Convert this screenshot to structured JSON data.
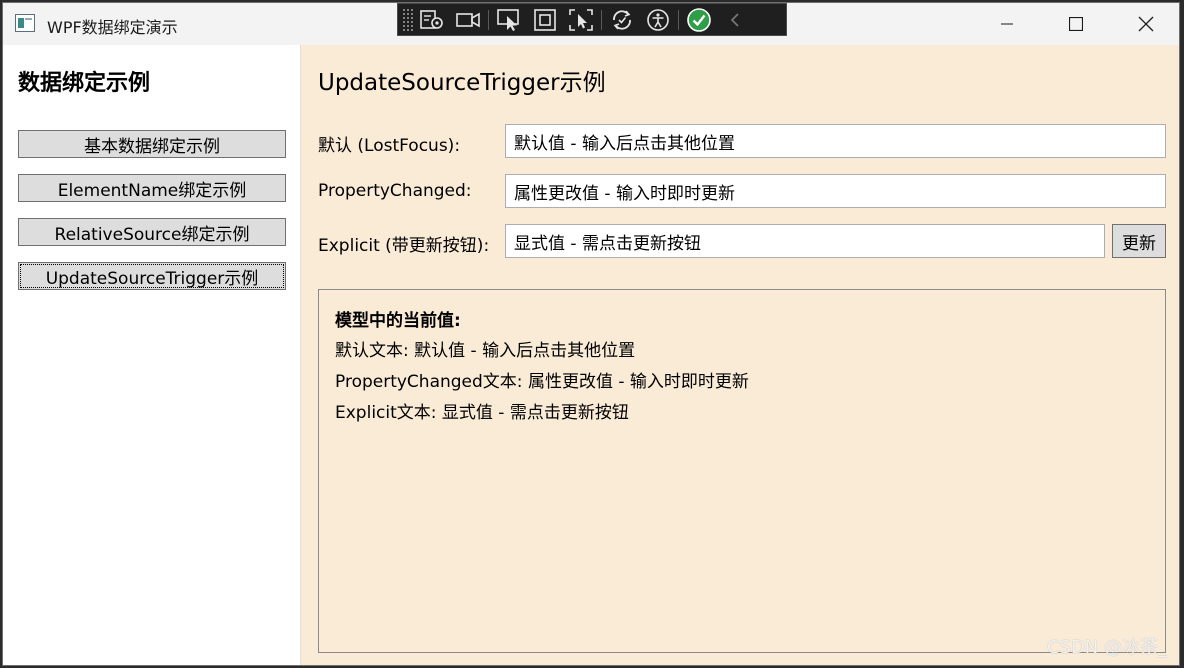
{
  "window": {
    "title": "WPF数据绑定演示"
  },
  "debug_toolbar": {
    "icons": [
      "select-element-icon",
      "record-icon",
      "inspect-pointer-icon",
      "layout-bounds-icon",
      "track-focus-icon",
      "hot-reload-icon",
      "accessibility-icon",
      "status-ok-icon",
      "collapse-chevron-icon"
    ]
  },
  "sidebar": {
    "title": "数据绑定示例",
    "items": [
      {
        "label": "基本数据绑定示例"
      },
      {
        "label": "ElementName绑定示例"
      },
      {
        "label": "RelativeSource绑定示例"
      },
      {
        "label": "UpdateSourceTrigger示例"
      }
    ]
  },
  "main": {
    "title": "UpdateSourceTrigger示例",
    "rows": [
      {
        "label": "默认 (LostFocus):",
        "value": "默认值 - 输入后点击其他位置"
      },
      {
        "label": "PropertyChanged:",
        "value": "属性更改值 - 输入时即时更新"
      },
      {
        "label": "Explicit (带更新按钮):",
        "value": "显式值 - 需点击更新按钮"
      }
    ],
    "update_button": "更新",
    "model": {
      "heading": "模型中的当前值:",
      "lines": [
        "默认文本: 默认值 - 输入后点击其他位置",
        "PropertyChanged文本: 属性更改值 - 输入时即时更新",
        "Explicit文本: 显式值 - 需点击更新按钮"
      ]
    }
  },
  "watermark": "CSDN @冰茶_",
  "colors": {
    "main_background": "#faebd7",
    "button_face": "#dddddd",
    "status_ok": "#2e9e48"
  }
}
